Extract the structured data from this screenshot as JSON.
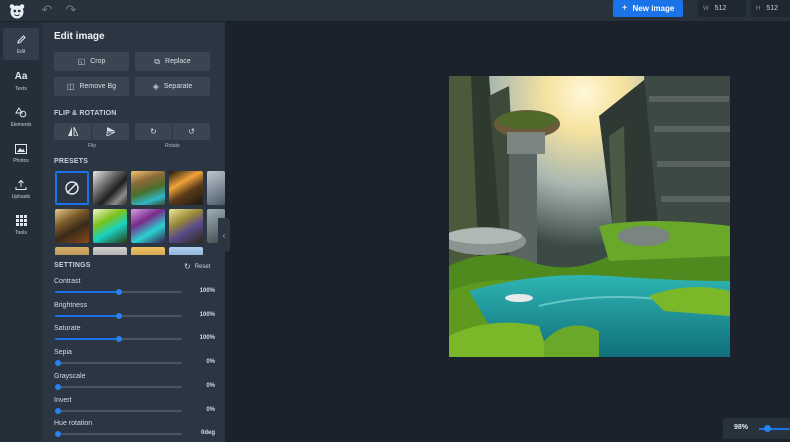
{
  "topbar": {
    "new_image_label": "New image",
    "width_key": "W",
    "width_value": "512",
    "height_key": "H",
    "height_value": "512"
  },
  "rail": [
    {
      "label": "Edit",
      "icon": "pencil-icon",
      "active": true
    },
    {
      "label": "Texts",
      "icon": "text-icon"
    },
    {
      "label": "Elements",
      "icon": "shapes-icon"
    },
    {
      "label": "Photos",
      "icon": "image-icon"
    },
    {
      "label": "Uploads",
      "icon": "upload-icon"
    },
    {
      "label": "Tools",
      "icon": "grid-icon"
    }
  ],
  "panel": {
    "title": "Edit image",
    "crop_label": "Crop",
    "replace_label": "Replace",
    "remove_bg_label": "Remove Bg",
    "separate_label": "Separate",
    "flip_rotation_title": "FLIP & ROTATION",
    "flip_caption": "Flip",
    "rotate_caption": "Rotate",
    "presets_title": "PRESETS",
    "settings_title": "SETTINGS",
    "reset_label": "Reset"
  },
  "settings": [
    {
      "label": "Contrast",
      "value": "100%",
      "level": 0.5
    },
    {
      "label": "Brightness",
      "value": "100%",
      "level": 0.5
    },
    {
      "label": "Saturate",
      "value": "100%",
      "level": 0.5
    },
    {
      "label": "Sepia",
      "value": "0%",
      "level": 0
    },
    {
      "label": "Grayscale",
      "value": "0%",
      "level": 0
    },
    {
      "label": "Invert",
      "value": "0%",
      "level": 0
    },
    {
      "label": "Hue rotation",
      "value": "0deg",
      "level": 0
    }
  ],
  "zoom": {
    "value": "98%"
  },
  "colors": {
    "accent": "#1a73e8",
    "panel": "#2c3642",
    "workspace": "#1b222b"
  }
}
